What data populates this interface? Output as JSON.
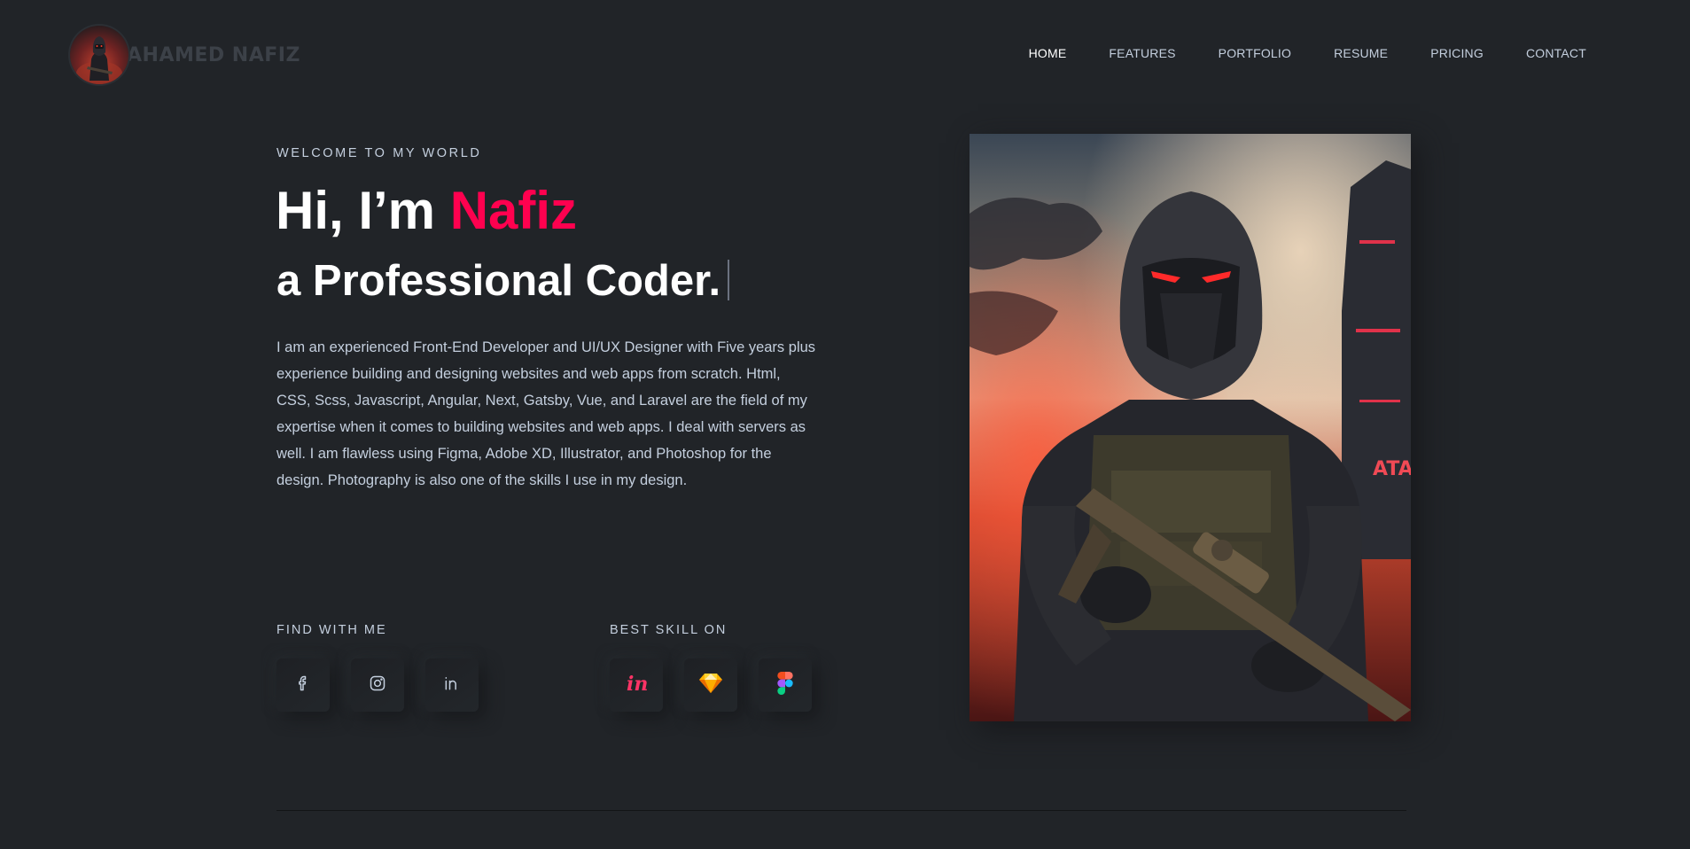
{
  "header": {
    "logo_text": "AHAMED NAFIZ",
    "nav": [
      {
        "label": "HOME",
        "active": true
      },
      {
        "label": "FEATURES",
        "active": false
      },
      {
        "label": "PORTFOLIO",
        "active": false
      },
      {
        "label": "RESUME",
        "active": false
      },
      {
        "label": "PRICING",
        "active": false
      },
      {
        "label": "CONTACT",
        "active": false
      }
    ]
  },
  "hero": {
    "kicker": "WELCOME TO MY WORLD",
    "greeting": "Hi, I’m ",
    "name": "Nafiz",
    "subtitle_prefix": "a",
    "subtitle": "Professional Coder.",
    "description": "I am an experienced Front-End Developer and UI/UX Designer with Five years plus experience building and designing websites and web apps from scratch. Html, CSS, Scss, Javascript, Angular, Next, Gatsby, Vue, and Laravel are the field of my expertise when it comes to building websites and web apps. I deal with servers as well. I am flawless using Figma, Adobe XD, Illustrator, and Photoshop for the design. Photography is also one of the skills I use in my design."
  },
  "social": {
    "label": "FIND WITH ME",
    "icons": [
      "facebook-icon",
      "instagram-icon",
      "linkedin-icon"
    ]
  },
  "skills": {
    "label": "BEST SKILL ON",
    "icons": [
      "invision-icon",
      "sketch-icon",
      "figma-icon"
    ]
  },
  "colors": {
    "background": "#212428",
    "accent": "#ff014f",
    "text": "#c4cfde",
    "heading": "#ffffff"
  }
}
